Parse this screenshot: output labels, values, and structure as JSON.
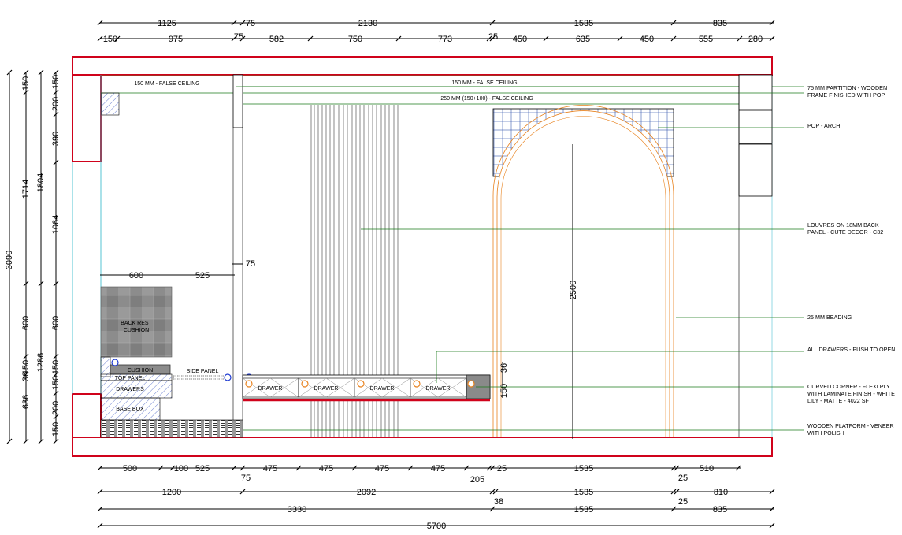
{
  "drawing": {
    "dims_top_row1": [
      "1125",
      "75",
      "2130",
      "1535",
      "835"
    ],
    "dims_top_row2": [
      "150",
      "975",
      "75",
      "582",
      "750",
      "773",
      "25",
      "450",
      "635",
      "450",
      "555",
      "280"
    ],
    "dims_left_outer": [
      "3090"
    ],
    "dims_left_mid": [
      "150",
      "1714",
      "600",
      "150",
      "36",
      "636"
    ],
    "dims_left_mid2": [
      "1804",
      "1286"
    ],
    "dims_left_inner": [
      "150",
      "200",
      "390",
      "1064",
      "600",
      "150",
      "150",
      "200",
      "150"
    ],
    "dims_bottom_row1": [
      "500",
      "100",
      "525",
      "75",
      "475",
      "475",
      "475",
      "475",
      "205",
      "25",
      "1535",
      "25",
      "510"
    ],
    "dims_bottom_row2": [
      "1200",
      "2092",
      "38",
      "1535",
      "25",
      "810"
    ],
    "dims_bottom_row3": [
      "3330",
      "1535",
      "835"
    ],
    "dims_bottom_row4": [
      "5700"
    ],
    "dims_bench": [
      "600",
      "525",
      "75"
    ],
    "dims_misc": [
      "2500",
      "150",
      "36"
    ],
    "labels": {
      "false_ceiling_left": "150 MM - FALSE CEILING",
      "false_ceiling_mid": "150 MM - FALSE CEILING",
      "false_ceiling_250": "250 MM (150+100) - FALSE CEILING",
      "back_rest": "BACK REST",
      "cushion_back": "CUSHION",
      "cushion": "CUSHION",
      "top_panel": "TOP PANEL",
      "drawers": "DRAWERS",
      "base_box": "BASE BOX",
      "side_panel": "SIDE PANEL",
      "drawer": "DRAWER"
    },
    "notes": [
      [
        "75 MM PARTITION - WOODEN",
        "FRAME FINISHED WITH POP"
      ],
      [
        "POP - ARCH"
      ],
      [
        "LOUVRES ON 18MM BACK",
        "PANEL - CUTE DECOR - C32"
      ],
      [
        "25 MM BEADING"
      ],
      [
        "ALL DRAWERS - PUSH TO OPEN"
      ],
      [
        "CURVED CORNER - FLEXI PLY",
        "WITH LAMINATE FINISH - WHITE",
        "LILY - MATTE - 4022 SF"
      ],
      [
        "WOODEN PLATFORM - VENEER",
        "WITH POLISH"
      ]
    ],
    "colors": {
      "red": "#d0021b",
      "green": "#1a7a1a",
      "cyan": "#2bb5c8",
      "orange": "#e8821e",
      "blue": "#1f3bd1"
    }
  }
}
